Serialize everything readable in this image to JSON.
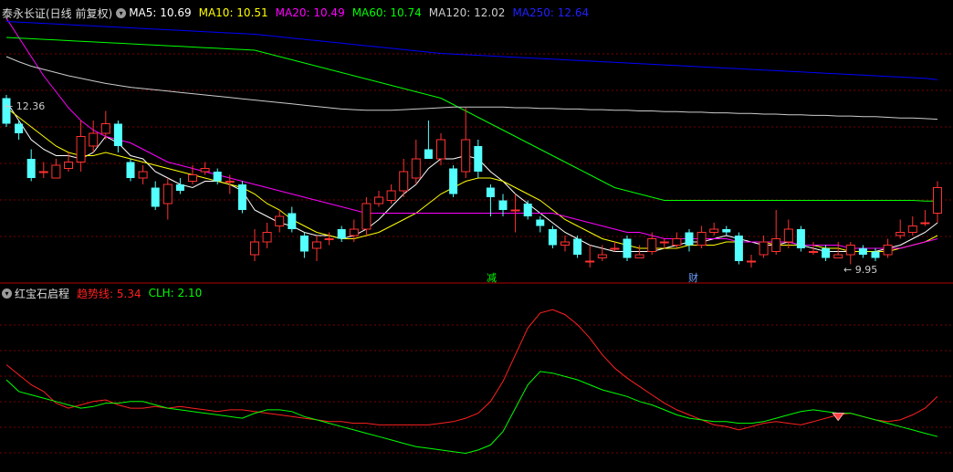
{
  "main_panel": {
    "title": "泰永长证(日线 前复权)",
    "indicators": [
      {
        "label": "MA5: 10.69",
        "color": "#ffffff"
      },
      {
        "label": "MA10: 10.51",
        "color": "#ffff00"
      },
      {
        "label": "MA20: 10.49",
        "color": "#ff00ff"
      },
      {
        "label": "MA60: 10.74",
        "color": "#00ff00"
      },
      {
        "label": "MA120: 12.02",
        "color": "#cccccc"
      },
      {
        "label": "MA250: 12.64",
        "color": "#0000ff"
      }
    ],
    "high_label": "12.36",
    "low_label": "9.95",
    "event_marks": [
      "减",
      "财"
    ]
  },
  "sub_panel": {
    "title": "红宝石启程",
    "indicators": [
      {
        "label": "趋势线: 5.34",
        "color": "#ff2020"
      },
      {
        "label": "CLH: 2.10",
        "color": "#00ff00"
      }
    ]
  },
  "colors": {
    "background": "#000000",
    "up": "#ff3232",
    "down": "#54ffff",
    "grid": "#7a0000"
  },
  "chart_data": {
    "type": "candlestick",
    "y_range": [
      9.6,
      13.6
    ],
    "candles": [
      [
        12.35,
        11.95,
        12.4,
        11.9
      ],
      [
        11.95,
        11.8,
        12.0,
        11.7
      ],
      [
        11.4,
        11.1,
        11.55,
        11.05
      ],
      [
        11.2,
        11.2,
        11.35,
        11.1
      ],
      [
        11.1,
        11.3,
        11.4,
        11.1
      ],
      [
        11.25,
        11.35,
        11.5,
        11.2
      ],
      [
        11.35,
        11.75,
        12.0,
        11.2
      ],
      [
        11.6,
        11.8,
        12.0,
        11.5
      ],
      [
        11.8,
        11.95,
        12.15,
        11.7
      ],
      [
        11.95,
        11.6,
        12.0,
        11.5
      ],
      [
        11.35,
        11.1,
        11.4,
        11.05
      ],
      [
        11.1,
        11.2,
        11.3,
        11.0
      ],
      [
        10.95,
        10.65,
        11.05,
        10.6
      ],
      [
        10.7,
        11.0,
        11.1,
        10.45
      ],
      [
        11.0,
        10.9,
        11.1,
        10.85
      ],
      [
        11.05,
        11.15,
        11.3,
        11.0
      ],
      [
        11.2,
        11.25,
        11.35,
        11.15
      ],
      [
        11.2,
        11.05,
        11.25,
        11.0
      ],
      [
        11.05,
        11.05,
        11.15,
        10.85
      ],
      [
        11.0,
        10.6,
        11.05,
        10.55
      ],
      [
        9.9,
        10.1,
        10.3,
        9.8
      ],
      [
        10.1,
        10.25,
        10.4,
        10.0
      ],
      [
        10.35,
        10.5,
        10.6,
        10.25
      ],
      [
        10.55,
        10.3,
        10.65,
        10.25
      ],
      [
        10.2,
        9.95,
        10.25,
        9.85
      ],
      [
        10.0,
        10.1,
        10.2,
        9.8
      ],
      [
        10.15,
        10.15,
        10.25,
        10.05
      ],
      [
        10.3,
        10.15,
        10.35,
        10.1
      ],
      [
        10.2,
        10.3,
        10.45,
        10.1
      ],
      [
        10.3,
        10.7,
        10.8,
        10.2
      ],
      [
        10.7,
        10.8,
        10.9,
        10.65
      ],
      [
        10.75,
        10.9,
        11.0,
        10.7
      ],
      [
        10.9,
        11.2,
        11.4,
        10.8
      ],
      [
        11.1,
        11.4,
        11.7,
        11.0
      ],
      [
        11.55,
        11.4,
        12.0,
        11.4
      ],
      [
        11.4,
        11.7,
        11.8,
        11.3
      ],
      [
        11.25,
        10.85,
        11.3,
        10.8
      ],
      [
        11.2,
        11.7,
        12.2,
        11.1
      ],
      [
        11.6,
        11.2,
        11.7,
        11.1
      ],
      [
        10.95,
        10.8,
        11.0,
        10.5
      ],
      [
        10.75,
        10.6,
        10.85,
        10.5
      ],
      [
        10.6,
        10.6,
        10.85,
        10.25
      ],
      [
        10.7,
        10.5,
        10.75,
        10.45
      ],
      [
        10.45,
        10.35,
        10.5,
        10.25
      ],
      [
        10.3,
        10.05,
        10.35,
        10.0
      ],
      [
        10.05,
        10.1,
        10.2,
        9.95
      ],
      [
        10.15,
        9.9,
        10.2,
        9.85
      ],
      [
        9.8,
        9.8,
        10.05,
        9.7
      ],
      [
        9.85,
        9.9,
        10.05,
        9.8
      ],
      [
        10.0,
        10.0,
        10.1,
        9.95
      ],
      [
        10.15,
        9.85,
        10.2,
        9.8
      ],
      [
        9.85,
        9.9,
        10.05,
        9.85
      ],
      [
        9.95,
        10.15,
        10.25,
        9.9
      ],
      [
        10.1,
        10.1,
        10.15,
        10.0
      ],
      [
        10.05,
        10.15,
        10.25,
        10.0
      ],
      [
        10.25,
        10.05,
        10.3,
        9.95
      ],
      [
        10.05,
        10.25,
        10.35,
        10.0
      ],
      [
        10.25,
        10.3,
        10.4,
        10.2
      ],
      [
        10.3,
        10.25,
        10.35,
        10.2
      ],
      [
        10.2,
        9.8,
        10.25,
        9.75
      ],
      [
        9.8,
        9.8,
        9.9,
        9.7
      ],
      [
        9.9,
        10.1,
        10.2,
        9.85
      ],
      [
        9.95,
        10.15,
        10.6,
        9.9
      ],
      [
        10.1,
        10.3,
        10.45,
        10.0
      ],
      [
        10.3,
        10.0,
        10.35,
        9.95
      ],
      [
        9.95,
        9.95,
        10.1,
        9.9
      ],
      [
        10.0,
        9.85,
        10.05,
        9.8
      ],
      [
        9.85,
        9.9,
        10.1,
        9.85
      ],
      [
        9.9,
        10.05,
        10.1,
        9.75
      ],
      [
        10.0,
        9.9,
        10.05,
        9.85
      ],
      [
        9.95,
        9.85,
        10.0,
        9.8
      ],
      [
        9.9,
        10.05,
        10.15,
        9.85
      ],
      [
        10.2,
        10.25,
        10.45,
        10.15
      ],
      [
        10.25,
        10.35,
        10.5,
        10.2
      ],
      [
        10.4,
        10.4,
        10.6,
        10.35
      ],
      [
        10.55,
        10.95,
        11.05,
        10.4
      ]
    ],
    "ma_series": [
      {
        "name": "MA5",
        "values": [
          12.3,
          12.0,
          11.7,
          11.55,
          11.45,
          11.45,
          11.4,
          11.5,
          11.75,
          11.65,
          11.45,
          11.4,
          11.2,
          11.1,
          11.0,
          10.95,
          11.05,
          11.05,
          11.0,
          10.9,
          10.6,
          10.5,
          10.4,
          10.35,
          10.25,
          10.2,
          10.2,
          10.15,
          10.2,
          10.3,
          10.45,
          10.65,
          10.85,
          11.0,
          11.25,
          11.4,
          11.4,
          11.45,
          11.4,
          11.2,
          11.05,
          10.85,
          10.7,
          10.55,
          10.4,
          10.25,
          10.15,
          10.05,
          10.0,
          9.95,
          9.95,
          9.95,
          9.95,
          10.0,
          10.05,
          10.1,
          10.1,
          10.15,
          10.2,
          10.15,
          10.1,
          10.05,
          10.05,
          10.1,
          10.05,
          10.0,
          9.95,
          9.95,
          9.95,
          9.95,
          9.95,
          10.0,
          10.05,
          10.15,
          10.25,
          10.4
        ]
      },
      {
        "name": "MA10",
        "values": [
          12.2,
          12.05,
          11.9,
          11.75,
          11.6,
          11.5,
          11.45,
          11.45,
          11.5,
          11.45,
          11.4,
          11.35,
          11.3,
          11.25,
          11.2,
          11.15,
          11.1,
          11.05,
          11.0,
          10.95,
          10.85,
          10.7,
          10.6,
          10.45,
          10.35,
          10.25,
          10.2,
          10.15,
          10.15,
          10.2,
          10.25,
          10.35,
          10.45,
          10.55,
          10.7,
          10.85,
          10.95,
          11.05,
          11.1,
          11.1,
          11.05,
          10.95,
          10.85,
          10.75,
          10.6,
          10.45,
          10.35,
          10.25,
          10.15,
          10.1,
          10.05,
          10.0,
          10.0,
          10.0,
          10.0,
          10.05,
          10.05,
          10.05,
          10.1,
          10.1,
          10.1,
          10.1,
          10.05,
          10.05,
          10.05,
          10.05,
          10.0,
          10.0,
          9.95,
          9.95,
          9.95,
          9.95,
          10.0,
          10.05,
          10.1,
          10.2
        ]
      },
      {
        "name": "MA20",
        "values": [
          13.6,
          13.3,
          13.0,
          12.7,
          12.45,
          12.2,
          12.0,
          11.85,
          11.75,
          11.7,
          11.65,
          11.55,
          11.45,
          11.35,
          11.3,
          11.25,
          11.2,
          11.15,
          11.1,
          11.05,
          11.0,
          10.95,
          10.9,
          10.85,
          10.8,
          10.75,
          10.7,
          10.65,
          10.6,
          10.55,
          10.55,
          10.55,
          10.55,
          10.55,
          10.55,
          10.55,
          10.55,
          10.55,
          10.55,
          10.55,
          10.55,
          10.55,
          10.55,
          10.55,
          10.55,
          10.5,
          10.45,
          10.4,
          10.35,
          10.3,
          10.25,
          10.25,
          10.2,
          10.15,
          10.15,
          10.15,
          10.15,
          10.15,
          10.15,
          10.1,
          10.1,
          10.1,
          10.1,
          10.1,
          10.05,
          10.05,
          10.05,
          10.05,
          10.0,
          10.0,
          10.0,
          10.0,
          10.0,
          10.05,
          10.1,
          10.15
        ]
      },
      {
        "name": "MA60",
        "values": [
          13.3,
          13.29,
          13.28,
          13.27,
          13.26,
          13.25,
          13.24,
          13.23,
          13.22,
          13.21,
          13.2,
          13.19,
          13.18,
          13.17,
          13.16,
          13.15,
          13.14,
          13.13,
          13.12,
          13.11,
          13.1,
          13.05,
          13.0,
          12.95,
          12.9,
          12.85,
          12.8,
          12.75,
          12.7,
          12.65,
          12.6,
          12.55,
          12.5,
          12.45,
          12.4,
          12.35,
          12.25,
          12.15,
          12.05,
          11.95,
          11.85,
          11.75,
          11.65,
          11.55,
          11.45,
          11.35,
          11.25,
          11.15,
          11.05,
          10.95,
          10.9,
          10.85,
          10.8,
          10.75,
          10.75,
          10.75,
          10.75,
          10.75,
          10.75,
          10.75,
          10.75,
          10.75,
          10.75,
          10.75,
          10.75,
          10.75,
          10.75,
          10.75,
          10.75,
          10.75,
          10.75,
          10.75,
          10.75,
          10.75,
          10.74,
          10.74
        ]
      },
      {
        "name": "MA120",
        "values": [
          13.0,
          12.92,
          12.85,
          12.8,
          12.75,
          12.7,
          12.66,
          12.62,
          12.58,
          12.55,
          12.52,
          12.5,
          12.48,
          12.46,
          12.44,
          12.42,
          12.4,
          12.38,
          12.36,
          12.34,
          12.32,
          12.3,
          12.28,
          12.26,
          12.24,
          12.22,
          12.2,
          12.18,
          12.17,
          12.16,
          12.16,
          12.16,
          12.17,
          12.18,
          12.19,
          12.2,
          12.21,
          12.21,
          12.21,
          12.21,
          12.21,
          12.2,
          12.2,
          12.19,
          12.19,
          12.18,
          12.18,
          12.17,
          12.17,
          12.16,
          12.16,
          12.15,
          12.15,
          12.14,
          12.14,
          12.13,
          12.13,
          12.12,
          12.12,
          12.11,
          12.11,
          12.1,
          12.1,
          12.09,
          12.09,
          12.08,
          12.08,
          12.07,
          12.07,
          12.06,
          12.06,
          12.05,
          12.04,
          12.04,
          12.03,
          12.02
        ]
      },
      {
        "name": "MA250",
        "values": [
          13.55,
          13.54,
          13.53,
          13.52,
          13.51,
          13.5,
          13.49,
          13.48,
          13.47,
          13.46,
          13.45,
          13.44,
          13.43,
          13.42,
          13.41,
          13.4,
          13.39,
          13.38,
          13.37,
          13.36,
          13.35,
          13.33,
          13.31,
          13.29,
          13.27,
          13.25,
          13.23,
          13.21,
          13.19,
          13.17,
          13.15,
          13.13,
          13.11,
          13.09,
          13.07,
          13.05,
          13.04,
          13.03,
          13.02,
          13.01,
          13.0,
          12.99,
          12.98,
          12.97,
          12.96,
          12.95,
          12.94,
          12.93,
          12.92,
          12.91,
          12.9,
          12.89,
          12.88,
          12.87,
          12.86,
          12.85,
          12.84,
          12.83,
          12.82,
          12.81,
          12.8,
          12.79,
          12.78,
          12.77,
          12.76,
          12.75,
          12.74,
          12.73,
          12.72,
          12.71,
          12.7,
          12.69,
          12.68,
          12.67,
          12.66,
          12.64
        ]
      }
    ],
    "sub_y_range": [
      0,
      10
    ],
    "sub_series": [
      {
        "name": "趋势线",
        "values": [
          6.2,
          5.6,
          5.0,
          4.6,
          3.9,
          3.6,
          3.8,
          4.0,
          4.1,
          3.8,
          3.6,
          3.6,
          3.7,
          3.6,
          3.7,
          3.6,
          3.5,
          3.4,
          3.5,
          3.5,
          3.4,
          3.3,
          3.2,
          3.1,
          3.0,
          2.9,
          2.8,
          2.8,
          2.7,
          2.7,
          2.6,
          2.6,
          2.6,
          2.6,
          2.6,
          2.7,
          2.8,
          3.0,
          3.3,
          4.0,
          5.2,
          6.8,
          8.4,
          9.3,
          9.5,
          9.2,
          8.6,
          7.8,
          6.8,
          6.0,
          5.4,
          4.9,
          4.4,
          3.9,
          3.5,
          3.2,
          2.9,
          2.6,
          2.5,
          2.3,
          2.5,
          2.7,
          2.8,
          2.7,
          2.6,
          2.8,
          3.0,
          3.2,
          3.3,
          3.1,
          2.9,
          2.8,
          2.9,
          3.2,
          3.6,
          4.3
        ]
      },
      {
        "name": "CLH",
        "values": [
          5.3,
          4.6,
          4.4,
          4.2,
          4.0,
          3.8,
          3.6,
          3.7,
          3.9,
          3.9,
          4.0,
          4.0,
          3.8,
          3.6,
          3.5,
          3.4,
          3.3,
          3.2,
          3.1,
          3.0,
          3.3,
          3.5,
          3.5,
          3.4,
          3.1,
          2.9,
          2.7,
          2.5,
          2.3,
          2.1,
          1.9,
          1.7,
          1.5,
          1.3,
          1.2,
          1.1,
          1.0,
          0.9,
          1.1,
          1.4,
          2.2,
          3.6,
          5.0,
          5.8,
          5.7,
          5.5,
          5.3,
          5.0,
          4.7,
          4.5,
          4.3,
          4.0,
          3.8,
          3.5,
          3.2,
          3.0,
          2.9,
          2.8,
          2.8,
          2.7,
          2.7,
          2.8,
          3.0,
          3.2,
          3.4,
          3.5,
          3.4,
          3.3,
          3.3,
          3.1,
          2.9,
          2.7,
          2.5,
          2.3,
          2.1,
          1.9
        ]
      }
    ]
  }
}
